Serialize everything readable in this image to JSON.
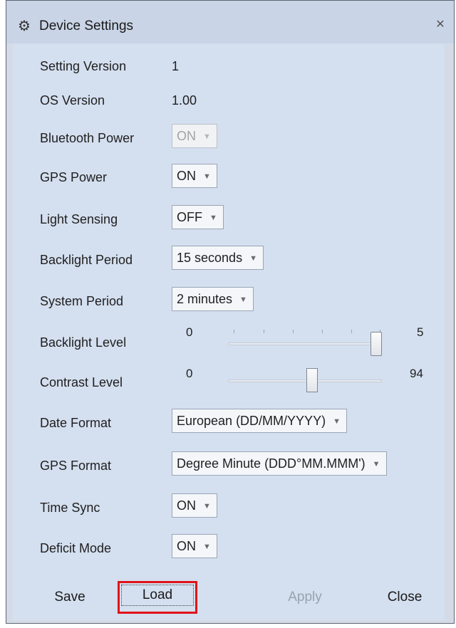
{
  "window": {
    "title": "Device Settings",
    "icon": "gear-icon",
    "close_glyph": "✕"
  },
  "fields": {
    "setting_version": {
      "label": "Setting Version",
      "value": "1"
    },
    "os_version": {
      "label": "OS Version",
      "value": "1.00"
    },
    "bluetooth_power": {
      "label": "Bluetooth Power",
      "value": "ON",
      "enabled": false
    },
    "gps_power": {
      "label": "GPS Power",
      "value": "ON"
    },
    "light_sensing": {
      "label": "Light Sensing",
      "value": "OFF"
    },
    "backlight_period": {
      "label": "Backlight Period",
      "value": "15 seconds"
    },
    "system_period": {
      "label": "System Period",
      "value": "2 minutes"
    },
    "backlight_level": {
      "label": "Backlight Level",
      "min": "0",
      "max": "5",
      "value_fraction": 1.0
    },
    "contrast_level": {
      "label": "Contrast Level",
      "min": "0",
      "max": "94",
      "value_fraction": 0.55
    },
    "date_format": {
      "label": "Date Format",
      "value": "European (DD/MM/YYYY)"
    },
    "gps_format": {
      "label": "GPS Format",
      "value": "Degree Minute (DDD°MM.MMM')"
    },
    "time_sync": {
      "label": "Time Sync",
      "value": "ON"
    },
    "deficit_mode": {
      "label": "Deficit Mode",
      "value": "ON"
    }
  },
  "buttons": {
    "save": "Save",
    "load": "Load",
    "apply": "Apply",
    "close": "Close"
  },
  "colors": {
    "focus_outline": "#e0141a",
    "window_bg": "#d4dfef"
  }
}
